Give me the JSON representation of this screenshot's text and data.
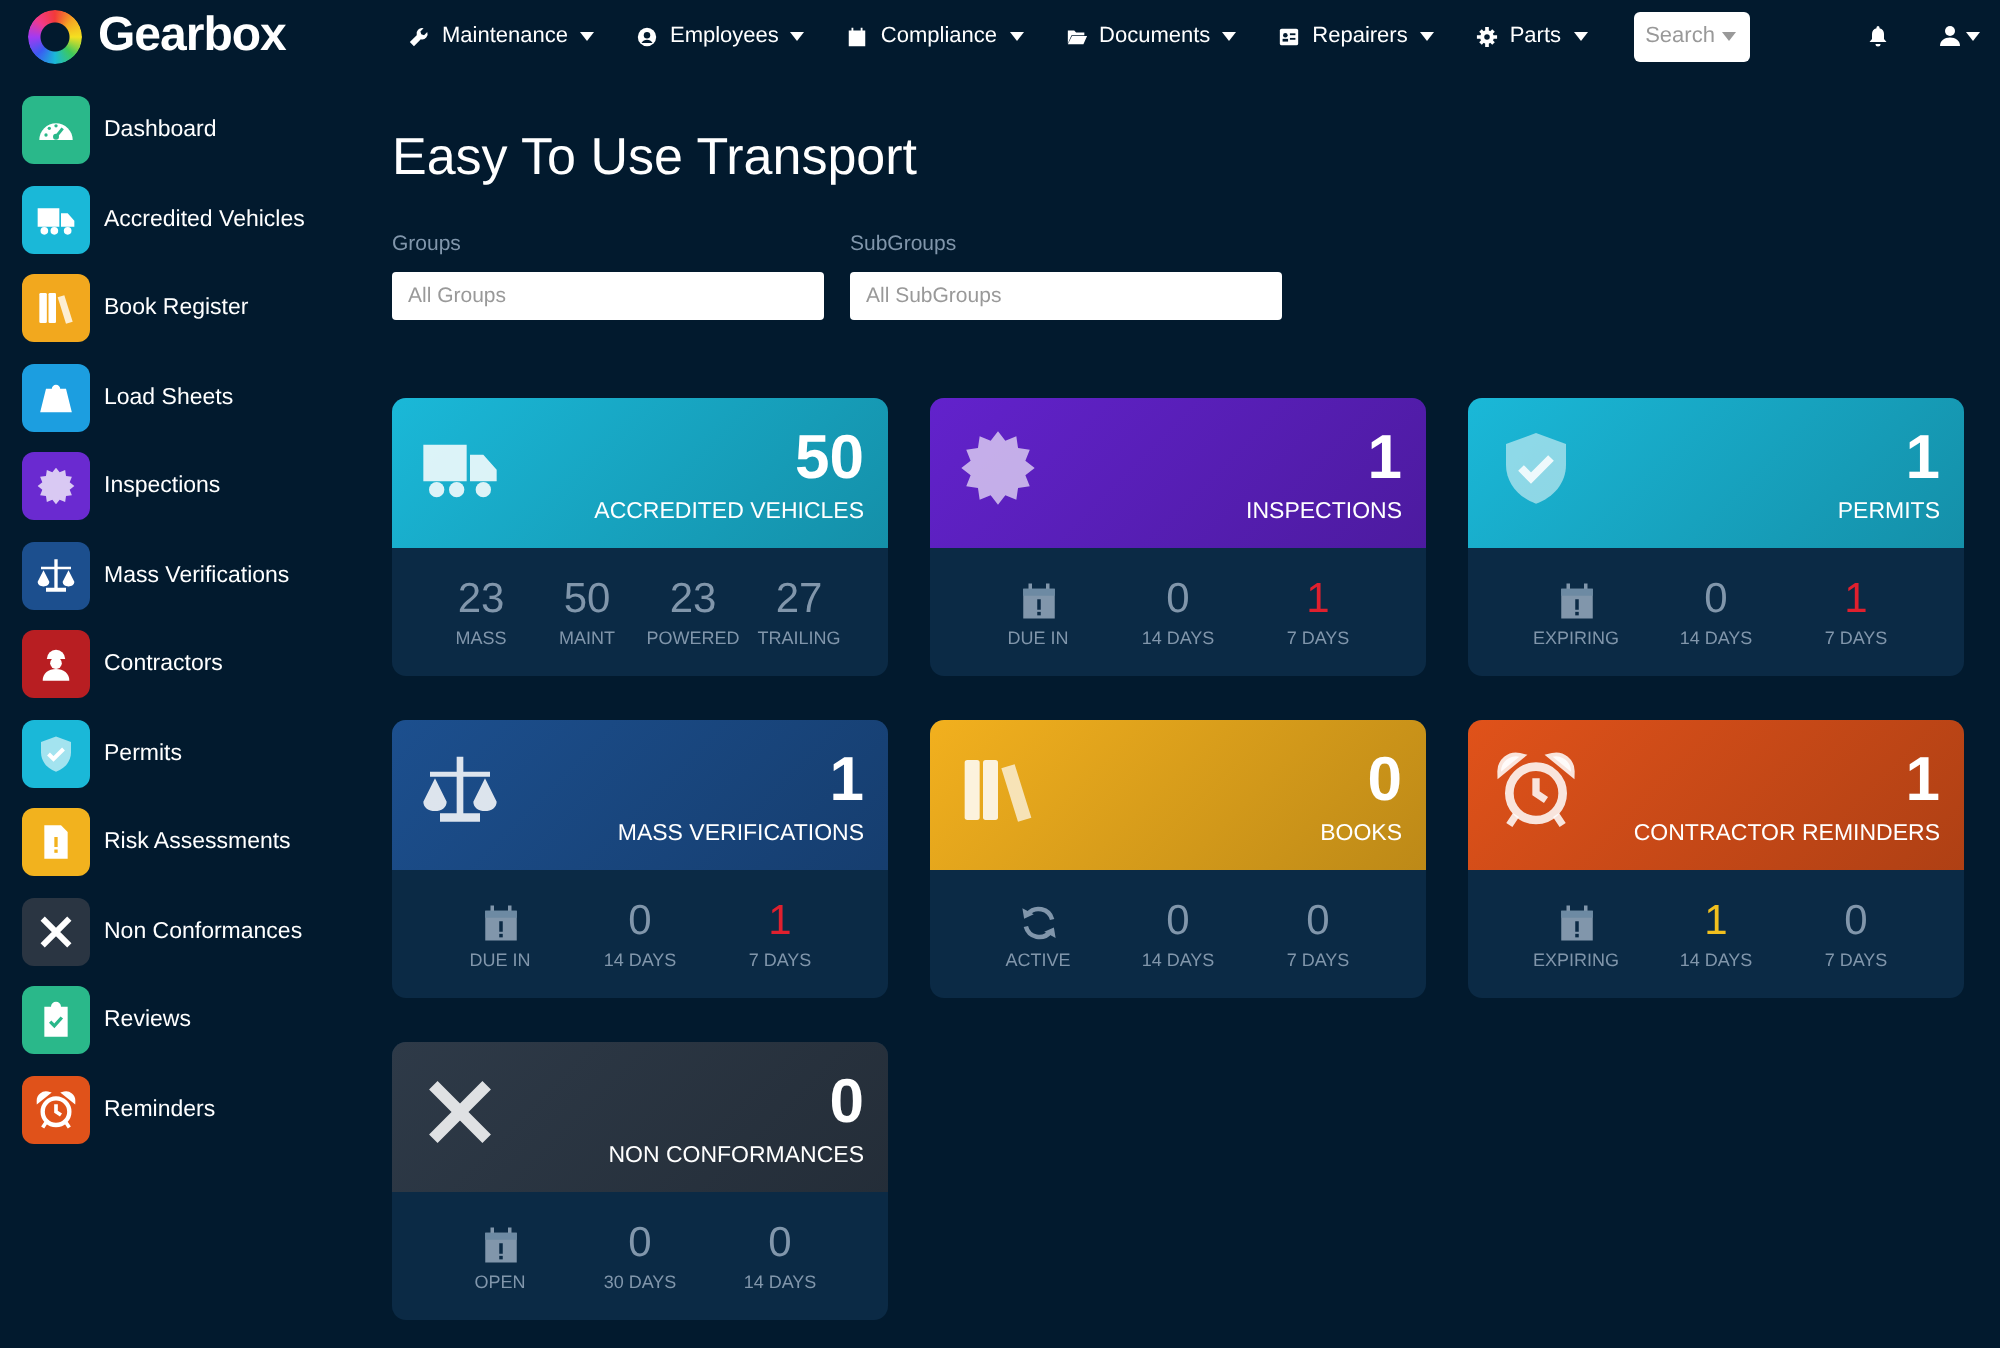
{
  "brand": {
    "name": "Gearbox"
  },
  "nav": [
    {
      "label": "Maintenance",
      "kind": "wrench"
    },
    {
      "label": "Employees",
      "kind": "person"
    },
    {
      "label": "Compliance",
      "kind": "calendar"
    },
    {
      "label": "Documents",
      "kind": "folder"
    },
    {
      "label": "Repairers",
      "kind": "card"
    },
    {
      "label": "Parts",
      "kind": "gear"
    }
  ],
  "search": {
    "label": "Search"
  },
  "sidebar": {
    "items": [
      {
        "label": "Dashboard",
        "kind": "gauge",
        "color": "#2ab88a"
      },
      {
        "label": "Accredited Vehicles",
        "kind": "truck",
        "color": "#1ab8d8"
      },
      {
        "label": "Book Register",
        "kind": "books",
        "color": "#f2a81e"
      },
      {
        "label": "Load Sheets",
        "kind": "weight",
        "color": "#1c9ee0"
      },
      {
        "label": "Inspections",
        "kind": "badge",
        "color": "#6a2ad0"
      },
      {
        "label": "Mass Verifications",
        "kind": "scale",
        "color": "#1c4f8e"
      },
      {
        "label": "Contractors",
        "kind": "worker",
        "color": "#b81e22"
      },
      {
        "label": "Permits",
        "kind": "shield",
        "color": "#1ab8d8"
      },
      {
        "label": "Risk Assessments",
        "kind": "file",
        "color": "#f2b21e"
      },
      {
        "label": "Non Conformances",
        "kind": "cross",
        "color": "#2a3542"
      },
      {
        "label": "Reviews",
        "kind": "clipboard",
        "color": "#2ab88a"
      },
      {
        "label": "Reminders",
        "kind": "alarm",
        "color": "#e0521a"
      }
    ]
  },
  "page": {
    "title": "Easy To Use Transport"
  },
  "filters": [
    {
      "label": "Groups",
      "placeholder": "All Groups"
    },
    {
      "label": "SubGroups",
      "placeholder": "All SubGroups"
    }
  ],
  "cards": [
    {
      "kind": "truck",
      "count": "50",
      "title": "ACCREDITED VEHICLES",
      "color": "#1ab8d8",
      "stats": [
        {
          "kind": "number",
          "value": "23",
          "label": "MASS"
        },
        {
          "kind": "number",
          "value": "50",
          "label": "MAINT"
        },
        {
          "kind": "number",
          "value": "23",
          "label": "POWERED"
        },
        {
          "kind": "number",
          "value": "27",
          "label": "TRAILING"
        }
      ]
    },
    {
      "kind": "badge",
      "count": "1",
      "title": "INSPECTIONS",
      "color": "#6222cc",
      "stats": [
        {
          "kind": "calendar",
          "label": "DUE IN"
        },
        {
          "kind": "number",
          "value": "0",
          "label": "14 DAYS"
        },
        {
          "kind": "number",
          "value": "1",
          "label": "7 DAYS",
          "color": "#e0202e"
        }
      ]
    },
    {
      "kind": "shield",
      "count": "1",
      "title": "PERMITS",
      "color": "#1ab8d8",
      "stats": [
        {
          "kind": "calendar",
          "label": "EXPIRING"
        },
        {
          "kind": "number",
          "value": "0",
          "label": "14 DAYS"
        },
        {
          "kind": "number",
          "value": "1",
          "label": "7 DAYS",
          "color": "#e0202e"
        }
      ]
    },
    {
      "kind": "scale",
      "count": "1",
      "title": "MASS VERIFICATIONS",
      "color": "#1c4f8e",
      "stats": [
        {
          "kind": "calendar",
          "label": "DUE IN"
        },
        {
          "kind": "number",
          "value": "0",
          "label": "14 DAYS"
        },
        {
          "kind": "number",
          "value": "1",
          "label": "7 DAYS",
          "color": "#e0202e"
        }
      ]
    },
    {
      "kind": "books",
      "count": "0",
      "title": "BOOKS",
      "color": "#f2b01e",
      "stats": [
        {
          "kind": "refresh",
          "label": "ACTIVE"
        },
        {
          "kind": "number",
          "value": "0",
          "label": "14 DAYS"
        },
        {
          "kind": "number",
          "value": "0",
          "label": "7 DAYS"
        }
      ]
    },
    {
      "kind": "alarm",
      "count": "1",
      "title": "CONTRACTOR REMINDERS",
      "color": "#e0521a",
      "stats": [
        {
          "kind": "calendar",
          "label": "EXPIRING"
        },
        {
          "kind": "number",
          "value": "1",
          "label": "14 DAYS",
          "color": "#f2c01e"
        },
        {
          "kind": "number",
          "value": "0",
          "label": "7 DAYS"
        }
      ]
    },
    {
      "kind": "cross",
      "count": "0",
      "title": "NON CONFORMANCES",
      "color": "#2e3a48",
      "stats": [
        {
          "kind": "calendar",
          "label": "OPEN"
        },
        {
          "kind": "number",
          "value": "0",
          "label": "30 DAYS"
        },
        {
          "kind": "number",
          "value": "0",
          "label": "14 DAYS"
        }
      ]
    }
  ]
}
